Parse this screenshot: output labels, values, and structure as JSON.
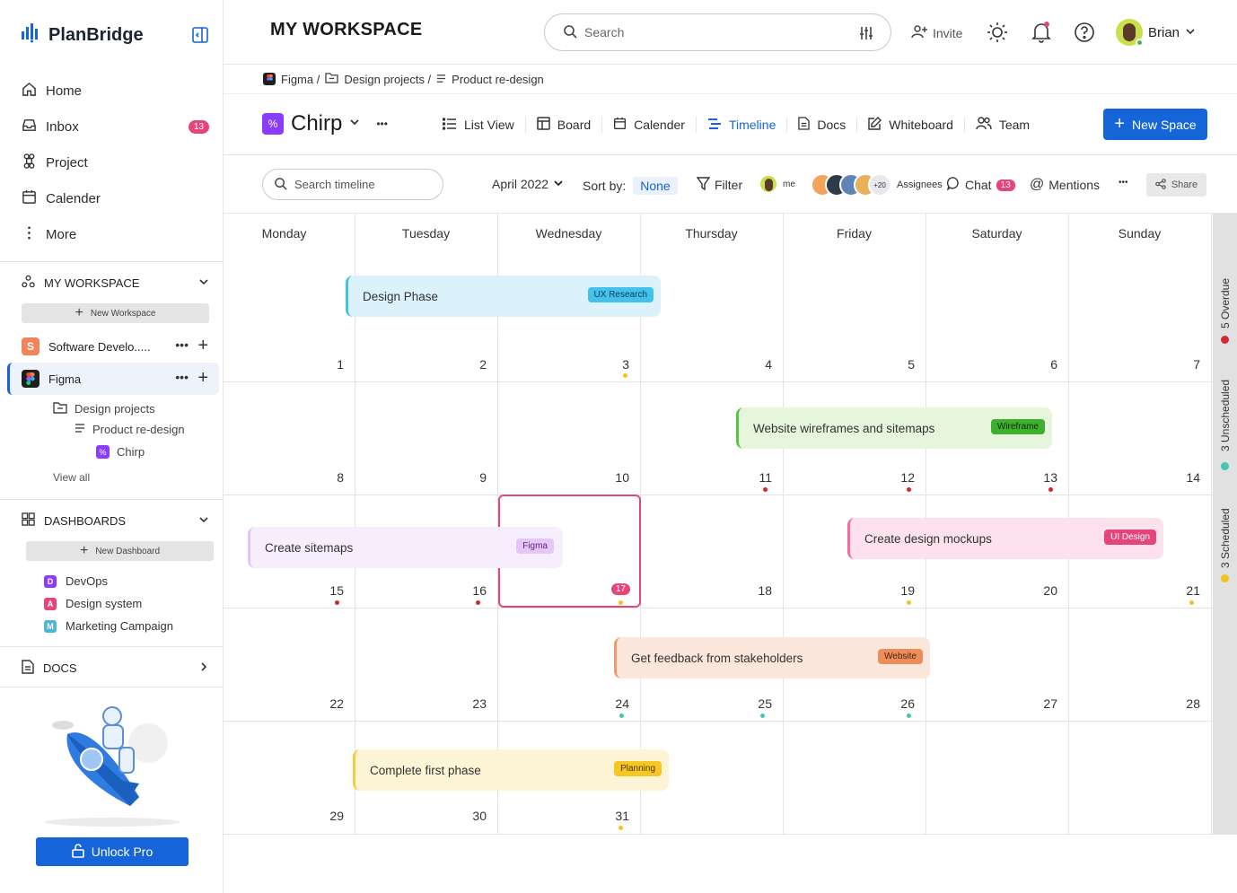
{
  "app": {
    "name": "PlanBridge"
  },
  "sidebar": {
    "nav": [
      {
        "label": "Home",
        "icon": "home-icon"
      },
      {
        "label": "Inbox",
        "icon": "inbox-icon",
        "badge": "13"
      },
      {
        "label": "Project",
        "icon": "command-icon"
      },
      {
        "label": "Calender",
        "icon": "calendar-icon"
      },
      {
        "label": "More",
        "icon": "more-vertical-icon"
      }
    ],
    "workspace_header": "MY WORKSPACE",
    "new_workspace": "New Workspace",
    "workspaces": [
      {
        "label": "Software Develo.....",
        "initial": "S",
        "color": "#f0845a"
      },
      {
        "label": "Figma",
        "initial": "",
        "color": "#1e1e1e"
      }
    ],
    "tree": {
      "folder": "Design projects",
      "list": "Product re-design",
      "space": "Chirp",
      "view_all": "View all"
    },
    "dashboards_header": "DASHBOARDS",
    "new_dashboard": "New Dashboard",
    "dashboards": [
      {
        "label": "DevOps",
        "initial": "D",
        "color": "#8b3dff"
      },
      {
        "label": "Design system",
        "initial": "A",
        "color": "#e6457a"
      },
      {
        "label": "Marketing Campaign",
        "initial": "M",
        "color": "#4cb5d9"
      }
    ],
    "docs_header": "DOCS",
    "unlock": "Unlock Pro"
  },
  "topbar": {
    "title": "MY WORKSPACE",
    "search_placeholder": "Search",
    "invite": "Invite",
    "user": "Brian"
  },
  "breadcrumb": {
    "root": "Figma /",
    "folder": "Design projects /",
    "list": "Product re-design"
  },
  "project": {
    "name": "Chirp",
    "new_space": "New Space"
  },
  "views": [
    "List View",
    "Board",
    "Calender",
    "Timeline",
    "Docs",
    "Whiteboard",
    "Team"
  ],
  "active_view": "Timeline",
  "toolbar": {
    "search_placeholder": "Search timeline",
    "month": "April 2022",
    "sort_label": "Sort by:",
    "sort_value": "None",
    "filter": "Filter",
    "me": "me",
    "more_count": "+20",
    "assignees": "Assignees",
    "chat": "Chat",
    "chat_count": "13",
    "mentions": "Mentions",
    "share": "Share"
  },
  "calendar": {
    "days": [
      "Monday",
      "Tuesday",
      "Wednesday",
      "Thursday",
      "Friday",
      "Saturday",
      "Sunday"
    ],
    "weeks": [
      [
        "1",
        "2",
        "3",
        "4",
        "5",
        "6",
        "7"
      ],
      [
        "8",
        "9",
        "10",
        "11",
        "12",
        "13",
        "14"
      ],
      [
        "15",
        "16",
        "17",
        "18",
        "19",
        "20",
        "21"
      ],
      [
        "22",
        "23",
        "24",
        "25",
        "26",
        "27",
        "28"
      ],
      [
        "29",
        "30",
        "31",
        "",
        "",
        "",
        ""
      ]
    ],
    "today_badge": "17",
    "events": [
      {
        "title": "Design Phase",
        "tag": "UX Research"
      },
      {
        "title": "Website wireframes and sitemaps",
        "tag": "Wireframe"
      },
      {
        "title": "Create sitemaps",
        "tag": "Figma"
      },
      {
        "title": "Create design mockups",
        "tag": "UI Design"
      },
      {
        "title": "Get feedback from stakeholders",
        "tag": "Website"
      },
      {
        "title": "Complete first phase",
        "tag": "Planning"
      }
    ]
  },
  "rail": {
    "overdue": "5 Overdue",
    "unscheduled": "3 Unscheduled",
    "scheduled": "3 Scheduled"
  }
}
